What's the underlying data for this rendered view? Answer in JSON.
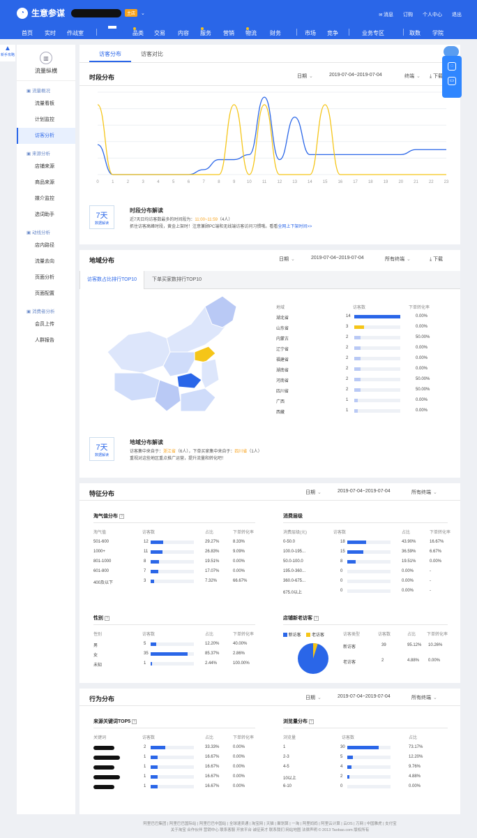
{
  "header": {
    "brand": "生意参谋",
    "shop_badge": "主店",
    "top_links": [
      "消息",
      "订购",
      "个人中心",
      "退出"
    ],
    "nav": [
      "首页",
      "实时",
      "作战室",
      "流量",
      "品类",
      "交易",
      "内容",
      "服务",
      "营销",
      "物流",
      "财务",
      "市场",
      "竞争",
      "业务专区",
      "取数",
      "学院"
    ],
    "nav_active": "流量"
  },
  "left_badge": "新手攻略",
  "sidebar": {
    "title": "流量纵横",
    "groups": [
      {
        "label": "流量概况",
        "items": [
          "流量看板",
          "计划监控",
          "访客分析"
        ]
      },
      {
        "label": "来源分析",
        "items": [
          "店铺来源",
          "商品来源",
          "媒介监控",
          "选词助手"
        ]
      },
      {
        "label": "动线分析",
        "items": [
          "店内路径",
          "流量去向",
          "页面分析",
          "页面配置"
        ]
      },
      {
        "label": "消费者分析",
        "items": [
          "会员上传",
          "人群报告"
        ]
      }
    ],
    "active": "访客分析"
  },
  "tabs": [
    "访客分布",
    "访客对比"
  ],
  "time_section": {
    "title": "时段分布",
    "filter_date": "日期",
    "date_range": "2019-07-04~2019-07-04",
    "terminal": "终端",
    "download": "下载",
    "insight_days": "7天",
    "insight_caption": "数据解读",
    "insight_title": "时段分布解读",
    "insight_line1_prefix": "近7天日均访客数最多的时间段为：",
    "insight_line1_time": "11:00~11:59",
    "insight_line1_count": "（4人）",
    "insight_line2": "抓住访客高峰时段，黄金上架时！注意兼顾PC端和无线端访客访问习惯哦。看看",
    "insight_line2_link": "全网上下架时间>>"
  },
  "chart_data": {
    "type": "line",
    "x": [
      "0",
      "1",
      "2",
      "3",
      "4",
      "5",
      "6",
      "7",
      "8",
      "9",
      "10",
      "11",
      "12",
      "13",
      "14",
      "15",
      "16",
      "17",
      "18",
      "19",
      "20",
      "21",
      "22",
      "23"
    ],
    "series": [
      {
        "values": [
          1.2,
          0,
          0,
          0,
          0,
          0,
          0,
          0.2,
          0.6,
          0.6,
          0.8,
          3.1,
          0.6,
          2.3,
          0.8,
          0.8,
          0.8,
          0.8,
          0.8,
          0.8,
          0.8,
          1.0,
          1.0,
          1.0
        ]
      },
      {
        "values": [
          2.8,
          0,
          0,
          0,
          0,
          0,
          0,
          0,
          0,
          2.8,
          0,
          2.8,
          0,
          0,
          0,
          2.8,
          0,
          0,
          0,
          0,
          0,
          0,
          0,
          0
        ]
      }
    ],
    "colors": [
      "#2a66e8",
      "#f5c518"
    ],
    "ylim": [
      0,
      3.3
    ],
    "grid": true
  },
  "geo_section": {
    "title": "地域分布",
    "filter_date": "日期",
    "date_range": "2019-07-04~2019-07-04",
    "terminal": "所有终端",
    "download": "下载",
    "subtabs": [
      "访客数占比排行TOP10",
      "下单买家数排行TOP10"
    ],
    "table_headers": [
      "地域",
      "访客数",
      "下单转化率"
    ],
    "rows": [
      {
        "region": "湖北省",
        "visitors": "14",
        "rate": "0.00%",
        "frac": 1.0,
        "style": "dark"
      },
      {
        "region": "山东省",
        "visitors": "3",
        "rate": "0.00%",
        "frac": 0.21,
        "style": "yellow"
      },
      {
        "region": "内蒙古",
        "visitors": "2",
        "rate": "50.00%",
        "frac": 0.14,
        "style": "light"
      },
      {
        "region": "辽宁省",
        "visitors": "2",
        "rate": "0.00%",
        "frac": 0.14,
        "style": "light"
      },
      {
        "region": "福建省",
        "visitors": "2",
        "rate": "0.00%",
        "frac": 0.14,
        "style": "light"
      },
      {
        "region": "湖南省",
        "visitors": "2",
        "rate": "0.00%",
        "frac": 0.14,
        "style": "light"
      },
      {
        "region": "河南省",
        "visitors": "2",
        "rate": "50.00%",
        "frac": 0.14,
        "style": "light"
      },
      {
        "region": "四川省",
        "visitors": "2",
        "rate": "50.00%",
        "frac": 0.14,
        "style": "light"
      },
      {
        "region": "广西",
        "visitors": "1",
        "rate": "0.00%",
        "frac": 0.07,
        "style": "light"
      },
      {
        "region": "西藏",
        "visitors": "1",
        "rate": "0.00%",
        "frac": 0.07,
        "style": "light"
      }
    ],
    "insight_days": "7天",
    "insight_caption": "数据解读",
    "insight_title": "地域分布解读",
    "insight_p1": "访客集中来自于：",
    "insight_p1_region": "浙江省",
    "insight_p1_count": "（6人），",
    "insight_p2": "下单买家集中来自于：",
    "insight_p2_region": "四川省",
    "insight_p2_count": "（1人）",
    "insight_line2": "重视对这些地区重点推广运营，提升流量和转化吧！"
  },
  "feature_section": {
    "title": "特征分布",
    "filter_date": "日期",
    "date_range": "2019-07-04~2019-07-04",
    "terminal": "所有终端",
    "taoqi": {
      "title": "淘气值分布",
      "headers": [
        "淘气值",
        "访客数",
        "占比",
        "下单转化率"
      ],
      "rows": [
        {
          "label": "501-600",
          "count": "12",
          "pct": "29.27%",
          "rate": "8.33%",
          "frac": 0.293
        },
        {
          "label": "1000+",
          "count": "11",
          "pct": "26.83%",
          "rate": "9.09%",
          "frac": 0.268
        },
        {
          "label": "801-1000",
          "count": "8",
          "pct": "19.51%",
          "rate": "0.00%",
          "frac": 0.195
        },
        {
          "label": "601-800",
          "count": "7",
          "pct": "17.07%",
          "rate": "0.00%",
          "frac": 0.171
        },
        {
          "label": "400及以下",
          "count": "3",
          "pct": "7.32%",
          "rate": "66.67%",
          "frac": 0.073
        }
      ]
    },
    "consume": {
      "title": "消费层级",
      "headers": [
        "消费层级(元)",
        "访客数",
        "占比",
        "下单转化率"
      ],
      "rows": [
        {
          "label": "0-50.0",
          "count": "18",
          "pct": "43.90%",
          "rate": "16.67%",
          "frac": 0.439
        },
        {
          "label": "100.0-195...",
          "count": "15",
          "pct": "36.59%",
          "rate": "6.67%",
          "frac": 0.366
        },
        {
          "label": "50.0-100.0",
          "count": "8",
          "pct": "19.51%",
          "rate": "0.00%",
          "frac": 0.195
        },
        {
          "label": "195.0-360...",
          "count": "0",
          "pct": "0.00%",
          "rate": "-",
          "frac": 0
        },
        {
          "label": "360.0-675...",
          "count": "0",
          "pct": "0.00%",
          "rate": "-",
          "frac": 0
        },
        {
          "label": "675.0以上",
          "count": "0",
          "pct": "0.00%",
          "rate": "-",
          "frac": 0
        }
      ]
    },
    "gender": {
      "title": "性别",
      "headers": [
        "性别",
        "访客数",
        "占比",
        "下单转化率"
      ],
      "rows": [
        {
          "label": "男",
          "count": "5",
          "pct": "12.20%",
          "rate": "40.00%",
          "frac": 0.122
        },
        {
          "label": "女",
          "count": "35",
          "pct": "85.37%",
          "rate": "2.86%",
          "frac": 0.854
        },
        {
          "label": "未知",
          "count": "1",
          "pct": "2.44%",
          "rate": "100.00%",
          "frac": 0.024
        }
      ]
    },
    "newold": {
      "title": "店铺新老访客",
      "legend": [
        "新访客",
        "老访客"
      ],
      "headers": [
        "访客类型",
        "访客数",
        "占比",
        "下单转化率"
      ],
      "rows": [
        {
          "label": "新访客",
          "count": "39",
          "pct": "95.12%",
          "rate": "10.26%"
        },
        {
          "label": "老访客",
          "count": "2",
          "pct": "4.88%",
          "rate": "0.00%"
        }
      ],
      "pie_fraction_new": 0.9512
    }
  },
  "behavior_section": {
    "title": "行为分布",
    "filter_date": "日期",
    "date_range": "2019-07-04~2019-07-04",
    "terminal": "所有终端",
    "keywords": {
      "title": "来源关键词TOP5",
      "headers": [
        "关键词",
        "访客数",
        "占比",
        "下单转化率"
      ],
      "rows": [
        {
          "count": "2",
          "pct": "33.33%",
          "rate": "0.00%",
          "frac": 0.333
        },
        {
          "count": "1",
          "pct": "16.67%",
          "rate": "0.00%",
          "frac": 0.167
        },
        {
          "count": "1",
          "pct": "16.67%",
          "rate": "0.00%",
          "frac": 0.167
        },
        {
          "count": "1",
          "pct": "16.67%",
          "rate": "0.00%",
          "frac": 0.167
        },
        {
          "count": "1",
          "pct": "16.67%",
          "rate": "0.00%",
          "frac": 0.167
        }
      ]
    },
    "pages": {
      "title": "浏览量分布",
      "headers": [
        "浏览量",
        "访客数",
        "占比"
      ],
      "rows": [
        {
          "label": "1",
          "count": "30",
          "pct": "73.17%",
          "frac": 0.732
        },
        {
          "label": "2-3",
          "count": "5",
          "pct": "12.20%",
          "frac": 0.122
        },
        {
          "label": "4-5",
          "count": "4",
          "pct": "9.76%",
          "frac": 0.098
        },
        {
          "label": "10以上",
          "count": "2",
          "pct": "4.88%",
          "frac": 0.049
        },
        {
          "label": "6-10",
          "count": "0",
          "pct": "0.00%",
          "frac": 0
        }
      ]
    }
  },
  "footer": {
    "line1": "阿里巴巴集团 | 阿里巴巴国际站 | 阿里巴巴中国站 | 全球速卖通 | 淘宝网 | 天猫 | 聚划算 | 一淘 | 阿里妈妈 | 阿里云计算 | 云OS | 万网 | 中国雅虎 | 支付宝",
    "line2": "关于淘宝 合作伙伴 营销中心 联系客服 开放平台 诚征英才 联系我们 网站地图 法律声明 © 2013 Taobao.com 版权所有"
  }
}
